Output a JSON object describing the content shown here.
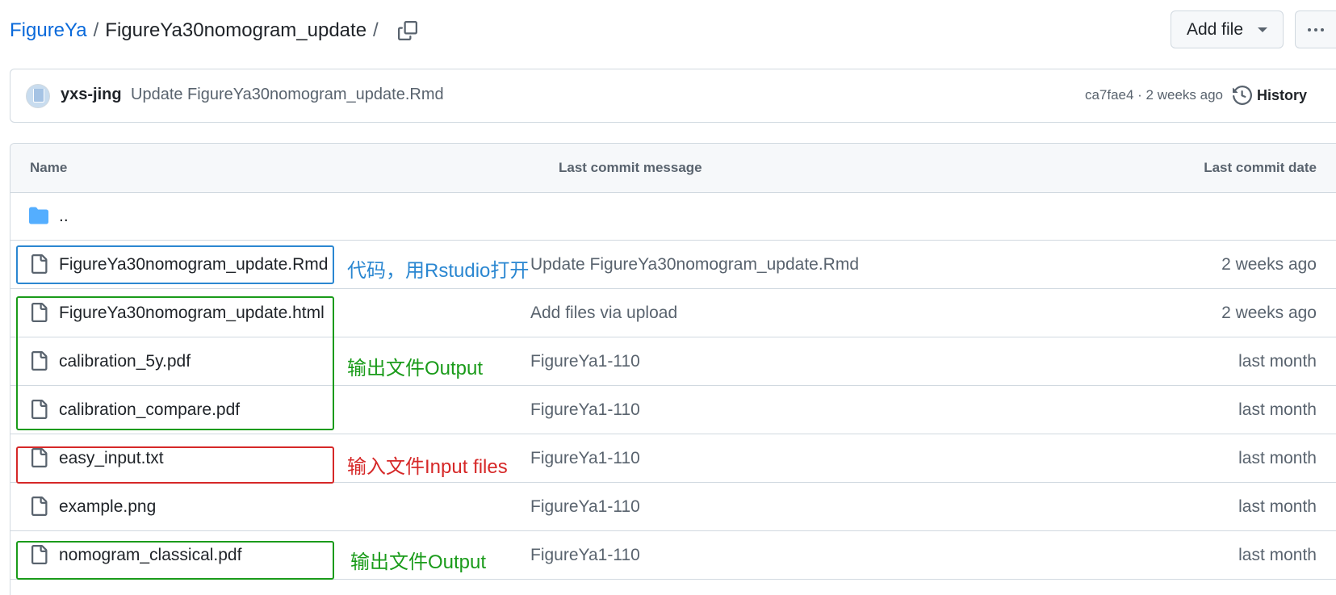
{
  "header": {
    "repo_link": "FigureYa",
    "separator": "/",
    "current_path": "FigureYa30nomogram_update",
    "trailing_separator": "/",
    "add_file_label": "Add file"
  },
  "commit": {
    "author": "yxs-jing",
    "message": "Update FigureYa30nomogram_update.Rmd",
    "meta": "ca7fae4 · 2 weeks ago",
    "history_label": "History"
  },
  "table": {
    "headers": {
      "name": "Name",
      "message": "Last commit message",
      "date": "Last commit date"
    },
    "parent_dir": "..",
    "files": [
      {
        "name": "FigureYa30nomogram_update.Rmd",
        "message": "Update FigureYa30nomogram_update.Rmd",
        "date": "2 weeks ago"
      },
      {
        "name": "FigureYa30nomogram_update.html",
        "message": "Add files via upload",
        "date": "2 weeks ago"
      },
      {
        "name": "calibration_5y.pdf",
        "message": "FigureYa1-110",
        "date": "last month"
      },
      {
        "name": "calibration_compare.pdf",
        "message": "FigureYa1-110",
        "date": "last month"
      },
      {
        "name": "easy_input.txt",
        "message": "FigureYa1-110",
        "date": "last month"
      },
      {
        "name": "example.png",
        "message": "FigureYa1-110",
        "date": "last month"
      },
      {
        "name": "nomogram_classical.pdf",
        "message": "FigureYa1-110",
        "date": "last month"
      }
    ]
  },
  "annotations": {
    "code": "代码，用Rstudio打开",
    "output": "输出文件Output",
    "input": "输入文件Input files",
    "output2": "输出文件Output"
  },
  "colors": {
    "link": "#0969da",
    "folder": "#54aeff",
    "anno_code": "#2b87d1",
    "anno_output": "#1a9b1a",
    "anno_input": "#d62828"
  },
  "icons": {
    "copy": "copy-icon",
    "caret": "triangle-down-icon",
    "more": "kebab-horizontal-icon",
    "history": "history-icon",
    "folder": "folder-icon",
    "file": "file-icon"
  }
}
